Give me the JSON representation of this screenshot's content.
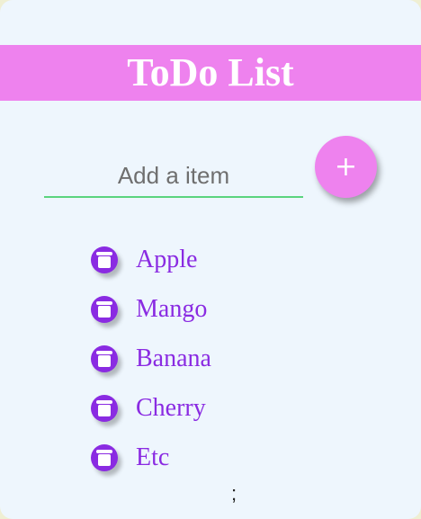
{
  "header": {
    "title": "ToDo List"
  },
  "input": {
    "placeholder": "Add a item",
    "value": ""
  },
  "add_button": {
    "label": "+"
  },
  "items": [
    {
      "label": "Apple"
    },
    {
      "label": "Mango"
    },
    {
      "label": "Banana"
    },
    {
      "label": "Cherry"
    },
    {
      "label": "Etc"
    }
  ],
  "stray_text": ";",
  "colors": {
    "accent": "#ee82ee",
    "item_text": "#8a2be2",
    "input_underline": "#5bd47e",
    "card_background": "#eef6fd",
    "page_background": "#efefd3"
  },
  "icons": {
    "delete": "trash-icon"
  }
}
